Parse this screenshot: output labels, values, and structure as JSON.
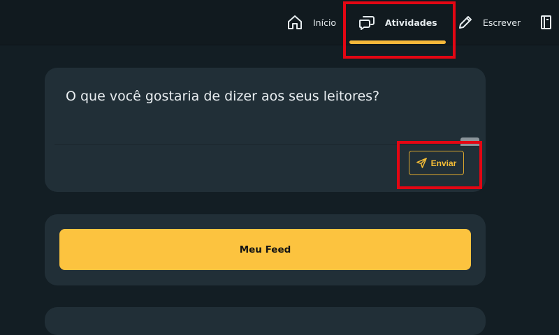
{
  "nav": {
    "items": [
      {
        "label": "Início",
        "icon": "home-icon"
      },
      {
        "label": "Atividades",
        "icon": "chat-bubbles-icon",
        "active": true
      },
      {
        "label": "Escrever",
        "icon": "pencil-icon"
      },
      {
        "label": "",
        "icon": "notebook-icon"
      }
    ],
    "accent_color": "#f5b83a"
  },
  "composer": {
    "placeholder": "O que você gostaria de dizer aos seus leitores?",
    "send_label": "Enviar",
    "send_icon": "send-icon"
  },
  "feed": {
    "button_label": "Meu Feed"
  },
  "highlight_color": "#e30613"
}
